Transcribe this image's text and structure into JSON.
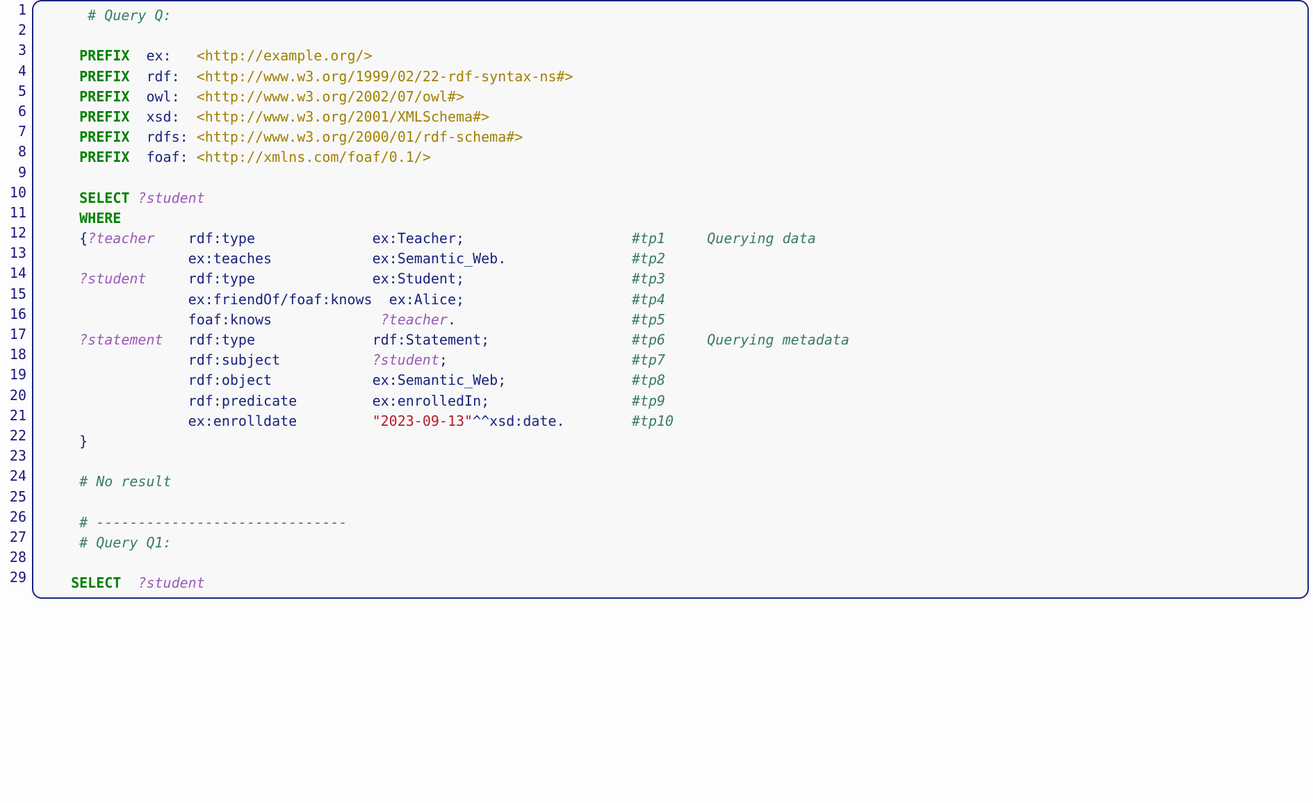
{
  "lines": [
    {
      "n": "1",
      "segs": [
        {
          "t": "    ",
          "c": ""
        },
        {
          "t": "# Query Q:",
          "c": "cmt"
        }
      ]
    },
    {
      "n": "2",
      "segs": []
    },
    {
      "n": "3",
      "segs": [
        {
          "t": "   ",
          "c": ""
        },
        {
          "t": "PREFIX",
          "c": "kw"
        },
        {
          "t": "  ",
          "c": ""
        },
        {
          "t": "ex:",
          "c": "pfx"
        },
        {
          "t": "   ",
          "c": ""
        },
        {
          "t": "<http://example.org/>",
          "c": "iri"
        }
      ]
    },
    {
      "n": "4",
      "segs": [
        {
          "t": "   ",
          "c": ""
        },
        {
          "t": "PREFIX",
          "c": "kw"
        },
        {
          "t": "  ",
          "c": ""
        },
        {
          "t": "rdf:",
          "c": "pfx"
        },
        {
          "t": "  ",
          "c": ""
        },
        {
          "t": "<http://www.w3.org/1999/02/22-rdf-syntax-ns#>",
          "c": "iri"
        }
      ]
    },
    {
      "n": "5",
      "segs": [
        {
          "t": "   ",
          "c": ""
        },
        {
          "t": "PREFIX",
          "c": "kw"
        },
        {
          "t": "  ",
          "c": ""
        },
        {
          "t": "owl:",
          "c": "pfx"
        },
        {
          "t": "  ",
          "c": ""
        },
        {
          "t": "<http://www.w3.org/2002/07/owl#>",
          "c": "iri"
        }
      ]
    },
    {
      "n": "6",
      "segs": [
        {
          "t": "   ",
          "c": ""
        },
        {
          "t": "PREFIX",
          "c": "kw"
        },
        {
          "t": "  ",
          "c": ""
        },
        {
          "t": "xsd:",
          "c": "pfx"
        },
        {
          "t": "  ",
          "c": ""
        },
        {
          "t": "<http://www.w3.org/2001/XMLSchema#>",
          "c": "iri"
        }
      ]
    },
    {
      "n": "7",
      "segs": [
        {
          "t": "   ",
          "c": ""
        },
        {
          "t": "PREFIX",
          "c": "kw"
        },
        {
          "t": "  ",
          "c": ""
        },
        {
          "t": "rdfs:",
          "c": "pfx"
        },
        {
          "t": " ",
          "c": ""
        },
        {
          "t": "<http://www.w3.org/2000/01/rdf-schema#>",
          "c": "iri"
        }
      ]
    },
    {
      "n": "8",
      "segs": [
        {
          "t": "   ",
          "c": ""
        },
        {
          "t": "PREFIX",
          "c": "kw"
        },
        {
          "t": "  ",
          "c": ""
        },
        {
          "t": "foaf:",
          "c": "pfx"
        },
        {
          "t": " ",
          "c": ""
        },
        {
          "t": "<http://xmlns.com/foaf/0.1/>",
          "c": "iri"
        }
      ]
    },
    {
      "n": "9",
      "segs": []
    },
    {
      "n": "10",
      "segs": [
        {
          "t": "   ",
          "c": ""
        },
        {
          "t": "SELECT",
          "c": "kw"
        },
        {
          "t": " ",
          "c": ""
        },
        {
          "t": "?student",
          "c": "var"
        }
      ]
    },
    {
      "n": "11",
      "segs": [
        {
          "t": "   ",
          "c": ""
        },
        {
          "t": "WHERE",
          "c": "kw"
        }
      ]
    },
    {
      "n": "12",
      "segs": [
        {
          "t": "   ",
          "c": ""
        },
        {
          "t": "{",
          "c": "punc"
        },
        {
          "t": "?teacher",
          "c": "var"
        },
        {
          "t": "    ",
          "c": ""
        },
        {
          "t": "rdf:type",
          "c": "val"
        },
        {
          "t": "              ",
          "c": ""
        },
        {
          "t": "ex:Teacher",
          "c": "val"
        },
        {
          "t": ";",
          "c": "punc"
        },
        {
          "t": "                    ",
          "c": ""
        },
        {
          "t": "#tp1     Querying data",
          "c": "cmt"
        }
      ]
    },
    {
      "n": "13",
      "segs": [
        {
          "t": "                ",
          "c": ""
        },
        {
          "t": "ex:teaches",
          "c": "val"
        },
        {
          "t": "            ",
          "c": ""
        },
        {
          "t": "ex:Semantic_Web",
          "c": "val"
        },
        {
          "t": ".",
          "c": "punc"
        },
        {
          "t": "               ",
          "c": ""
        },
        {
          "t": "#tp2",
          "c": "cmt"
        }
      ]
    },
    {
      "n": "14",
      "segs": [
        {
          "t": "   ",
          "c": ""
        },
        {
          "t": "?student",
          "c": "var"
        },
        {
          "t": "     ",
          "c": ""
        },
        {
          "t": "rdf:type",
          "c": "val"
        },
        {
          "t": "              ",
          "c": ""
        },
        {
          "t": "ex:Student",
          "c": "val"
        },
        {
          "t": ";",
          "c": "punc"
        },
        {
          "t": "                    ",
          "c": ""
        },
        {
          "t": "#tp3",
          "c": "cmt"
        }
      ]
    },
    {
      "n": "15",
      "segs": [
        {
          "t": "                ",
          "c": ""
        },
        {
          "t": "ex:friendOf/foaf:knows",
          "c": "val"
        },
        {
          "t": "  ",
          "c": ""
        },
        {
          "t": "ex:Alice",
          "c": "val"
        },
        {
          "t": ";",
          "c": "punc"
        },
        {
          "t": "                    ",
          "c": ""
        },
        {
          "t": "#tp4",
          "c": "cmt"
        }
      ]
    },
    {
      "n": "16",
      "segs": [
        {
          "t": "                ",
          "c": ""
        },
        {
          "t": "foaf:knows",
          "c": "val"
        },
        {
          "t": "             ",
          "c": ""
        },
        {
          "t": "?teacher",
          "c": "var"
        },
        {
          "t": ".",
          "c": "punc"
        },
        {
          "t": "                     ",
          "c": ""
        },
        {
          "t": "#tp5",
          "c": "cmt"
        }
      ]
    },
    {
      "n": "17",
      "segs": [
        {
          "t": "   ",
          "c": ""
        },
        {
          "t": "?statement",
          "c": "var"
        },
        {
          "t": "   ",
          "c": ""
        },
        {
          "t": "rdf:type",
          "c": "val"
        },
        {
          "t": "              ",
          "c": ""
        },
        {
          "t": "rdf:Statement",
          "c": "val"
        },
        {
          "t": ";",
          "c": "punc"
        },
        {
          "t": "                 ",
          "c": ""
        },
        {
          "t": "#tp6     Querying metadata",
          "c": "cmt"
        }
      ]
    },
    {
      "n": "18",
      "segs": [
        {
          "t": "                ",
          "c": ""
        },
        {
          "t": "rdf:subject",
          "c": "val"
        },
        {
          "t": "           ",
          "c": ""
        },
        {
          "t": "?student",
          "c": "var"
        },
        {
          "t": ";",
          "c": "punc"
        },
        {
          "t": "                      ",
          "c": ""
        },
        {
          "t": "#tp7",
          "c": "cmt"
        }
      ]
    },
    {
      "n": "19",
      "segs": [
        {
          "t": "                ",
          "c": ""
        },
        {
          "t": "rdf:object",
          "c": "val"
        },
        {
          "t": "            ",
          "c": ""
        },
        {
          "t": "ex:Semantic_Web",
          "c": "val"
        },
        {
          "t": ";",
          "c": "punc"
        },
        {
          "t": "               ",
          "c": ""
        },
        {
          "t": "#tp8",
          "c": "cmt"
        }
      ]
    },
    {
      "n": "20",
      "segs": [
        {
          "t": "                ",
          "c": ""
        },
        {
          "t": "rdf:predicate",
          "c": "val"
        },
        {
          "t": "         ",
          "c": ""
        },
        {
          "t": "ex:enrolledIn",
          "c": "val"
        },
        {
          "t": ";",
          "c": "punc"
        },
        {
          "t": "                 ",
          "c": ""
        },
        {
          "t": "#tp9",
          "c": "cmt"
        }
      ]
    },
    {
      "n": "21",
      "segs": [
        {
          "t": "                ",
          "c": ""
        },
        {
          "t": "ex:enrolldate",
          "c": "val"
        },
        {
          "t": "         ",
          "c": ""
        },
        {
          "t": "\"2023-09-13\"",
          "c": "lit"
        },
        {
          "t": "^^",
          "c": "caret"
        },
        {
          "t": "xsd:date",
          "c": "val"
        },
        {
          "t": ".",
          "c": "punc"
        },
        {
          "t": "        ",
          "c": ""
        },
        {
          "t": "#tp10",
          "c": "cmt"
        }
      ]
    },
    {
      "n": "22",
      "segs": [
        {
          "t": "   ",
          "c": ""
        },
        {
          "t": "}",
          "c": "punc"
        }
      ]
    },
    {
      "n": "23",
      "segs": []
    },
    {
      "n": "24",
      "segs": [
        {
          "t": "   ",
          "c": ""
        },
        {
          "t": "# No result",
          "c": "cmt"
        }
      ]
    },
    {
      "n": "25",
      "segs": []
    },
    {
      "n": "26",
      "segs": [
        {
          "t": "   ",
          "c": ""
        },
        {
          "t": "# ------------------------------",
          "c": "cmt"
        }
      ]
    },
    {
      "n": "27",
      "segs": [
        {
          "t": "   ",
          "c": ""
        },
        {
          "t": "# Query Q1:",
          "c": "cmt"
        }
      ]
    },
    {
      "n": "28",
      "segs": []
    },
    {
      "n": "29",
      "segs": [
        {
          "t": "  ",
          "c": ""
        },
        {
          "t": "SELECT",
          "c": "kw"
        },
        {
          "t": "  ",
          "c": ""
        },
        {
          "t": "?student",
          "c": "var"
        }
      ]
    }
  ]
}
